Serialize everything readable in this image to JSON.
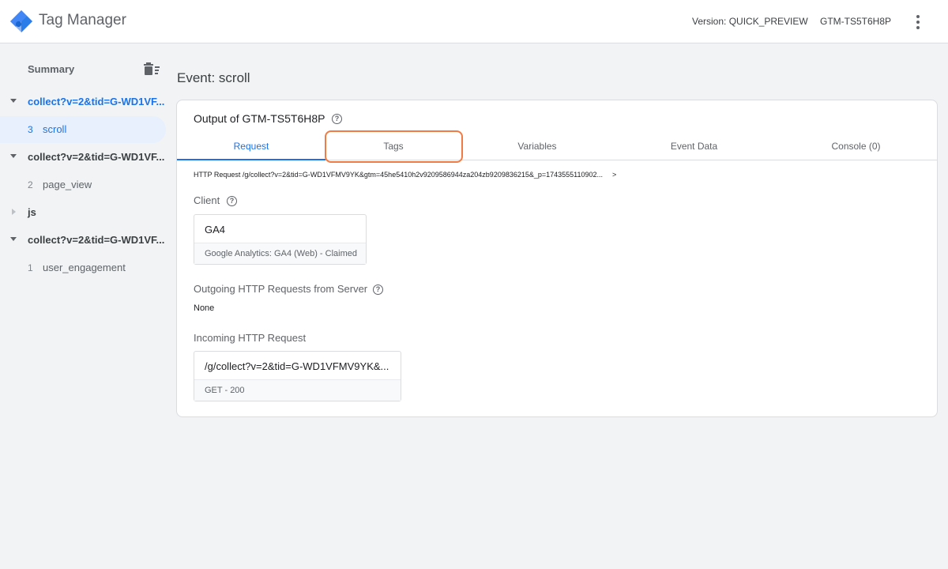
{
  "header": {
    "app_title": "Tag Manager",
    "version": "Version: QUICK_PREVIEW",
    "container_id": "GTM-TS5T6H8P",
    "logo_icon": "gtm-diamond-logo",
    "menu_icon": "more-vert-icon"
  },
  "sidebar": {
    "summary_label": "Summary",
    "clear_icon": "delete-sweep-icon",
    "groups": [
      {
        "label": "collect?v=2&tid=G-WD1VF...",
        "expanded": true,
        "active": true
      },
      {
        "label": "collect?v=2&tid=G-WD1VF...",
        "expanded": true,
        "active": false
      },
      {
        "label": "js",
        "expanded": false,
        "active": false
      },
      {
        "label": "collect?v=2&tid=G-WD1VF...",
        "expanded": true,
        "active": false
      }
    ],
    "events": [
      {
        "num": "3",
        "label": "scroll",
        "selected": true
      },
      {
        "num": "2",
        "label": "page_view",
        "selected": false
      },
      {
        "num": "1",
        "label": "user_engagement",
        "selected": false
      }
    ]
  },
  "main": {
    "event_title": "Event: scroll",
    "output_title": "Output of GTM-TS5T6H8P",
    "tabs": [
      {
        "label": "Request",
        "active": true
      },
      {
        "label": "Tags",
        "active": false
      },
      {
        "label": "Variables",
        "active": false
      },
      {
        "label": "Event Data",
        "active": false
      },
      {
        "label": "Console (0)",
        "active": false
      }
    ],
    "http_request_line": "HTTP Request /g/collect?v=2&tid=G-WD1VFMV9YK&gtm=45he5410h2v9209586944za204zb9209836215&_p=1743555110902...",
    "http_request_chevron": ">",
    "client": {
      "label": "Client",
      "name": "GA4",
      "detail": "Google Analytics: GA4 (Web) - Claimed"
    },
    "outgoing": {
      "label": "Outgoing HTTP Requests from Server",
      "value": "None"
    },
    "incoming": {
      "label": "Incoming HTTP Request",
      "url": "/g/collect?v=2&tid=G-WD1VFMV9YK&...",
      "status": "GET - 200"
    },
    "help_glyph": "?"
  },
  "colors": {
    "accent": "#1a73e8",
    "highlight": "#f07c45"
  }
}
